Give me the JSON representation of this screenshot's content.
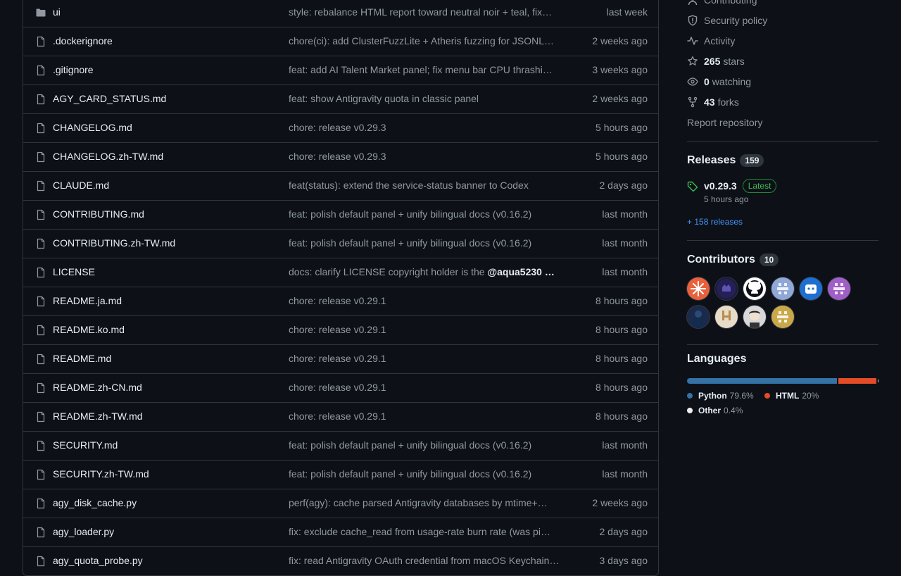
{
  "files": [
    {
      "name": "ui",
      "type": "folder",
      "message": "style: rebalance HTML report toward neutral noir + teal, fix…",
      "date": "last week"
    },
    {
      "name": ".dockerignore",
      "type": "file",
      "message": "chore(ci): add ClusterFuzzLite + Atheris fuzzing for JSONL…",
      "date": "2 weeks ago"
    },
    {
      "name": ".gitignore",
      "type": "file",
      "message": "feat: add AI Talent Market panel; fix menu bar CPU thrashi…",
      "date": "3 weeks ago"
    },
    {
      "name": "AGY_CARD_STATUS.md",
      "type": "file",
      "message": "feat: show Antigravity quota in classic panel",
      "date": "2 weeks ago"
    },
    {
      "name": "CHANGELOG.md",
      "type": "file",
      "message": "chore: release v0.29.3",
      "date": "5 hours ago"
    },
    {
      "name": "CHANGELOG.zh-TW.md",
      "type": "file",
      "message": "chore: release v0.29.3",
      "date": "5 hours ago"
    },
    {
      "name": "CLAUDE.md",
      "type": "file",
      "message": "feat(status): extend the service-status banner to Codex",
      "date": "2 days ago"
    },
    {
      "name": "CONTRIBUTING.md",
      "type": "file",
      "message": "feat: polish default panel + unify bilingual docs (v0.16.2)",
      "date": "last month"
    },
    {
      "name": "CONTRIBUTING.zh-TW.md",
      "type": "file",
      "message": "feat: polish default panel + unify bilingual docs (v0.16.2)",
      "date": "last month"
    },
    {
      "name": "LICENSE",
      "type": "file",
      "message": "docs: clarify LICENSE copyright holder is the ",
      "mention": "@aqua5230 …",
      "date": "last month"
    },
    {
      "name": "README.ja.md",
      "type": "file",
      "message": "chore: release v0.29.1",
      "date": "8 hours ago"
    },
    {
      "name": "README.ko.md",
      "type": "file",
      "message": "chore: release v0.29.1",
      "date": "8 hours ago"
    },
    {
      "name": "README.md",
      "type": "file",
      "message": "chore: release v0.29.1",
      "date": "8 hours ago"
    },
    {
      "name": "README.zh-CN.md",
      "type": "file",
      "message": "chore: release v0.29.1",
      "date": "8 hours ago"
    },
    {
      "name": "README.zh-TW.md",
      "type": "file",
      "message": "chore: release v0.29.1",
      "date": "8 hours ago"
    },
    {
      "name": "SECURITY.md",
      "type": "file",
      "message": "feat: polish default panel + unify bilingual docs (v0.16.2)",
      "date": "last month"
    },
    {
      "name": "SECURITY.zh-TW.md",
      "type": "file",
      "message": "feat: polish default panel + unify bilingual docs (v0.16.2)",
      "date": "last month"
    },
    {
      "name": "agy_disk_cache.py",
      "type": "file",
      "message": "perf(agy): cache parsed Antigravity databases by mtime+…",
      "date": "2 weeks ago"
    },
    {
      "name": "agy_loader.py",
      "type": "file",
      "message": "fix: exclude cache_read from usage-rate burn rate (was pi…",
      "date": "2 days ago"
    },
    {
      "name": "agy_quota_probe.py",
      "type": "file",
      "message": "fix: read Antigravity OAuth credential from macOS Keychain…",
      "date": "3 days ago"
    }
  ],
  "sidebar": {
    "contributing_label": "Contributing",
    "security_label": "Security policy",
    "activity_label": "Activity",
    "stars_count": "265",
    "stars_label": "stars",
    "watching_count": "0",
    "watching_label": "watching",
    "forks_count": "43",
    "forks_label": "forks",
    "report_label": "Report repository"
  },
  "releases": {
    "title": "Releases",
    "count": "159",
    "latest_tag": "v0.29.3",
    "latest_badge": "Latest",
    "latest_time": "5 hours ago",
    "more_link": "+ 158 releases"
  },
  "contributors": {
    "title": "Contributors",
    "count": "10",
    "avatars": [
      {
        "name": "avatar-1",
        "color": "#e8613c"
      },
      {
        "name": "avatar-2",
        "color": "#1a1b3a"
      },
      {
        "name": "avatar-3",
        "color": "#ffffff"
      },
      {
        "name": "avatar-4",
        "color": "#8fa8d8"
      },
      {
        "name": "avatar-5",
        "color": "#1f6fd1"
      },
      {
        "name": "avatar-6",
        "color": "#a05ec7"
      },
      {
        "name": "avatar-7",
        "color": "#1b2a4a"
      },
      {
        "name": "avatar-8",
        "color": "#e8dcc8"
      },
      {
        "name": "avatar-9",
        "color": "#d8d8d8"
      },
      {
        "name": "avatar-10",
        "color": "#c9a84a"
      }
    ]
  },
  "languages": {
    "title": "Languages",
    "items": [
      {
        "name": "Python",
        "percent": "79.6%",
        "value": 79.6,
        "color": "#3572a5"
      },
      {
        "name": "HTML",
        "percent": "20%",
        "value": 20,
        "color": "#e34c26"
      },
      {
        "name": "Other",
        "percent": "0.4%",
        "value": 0.4,
        "color": "#ededed"
      }
    ]
  },
  "colors": {
    "background": "#0d1117",
    "border": "#30363d",
    "muted": "#9198a1",
    "text": "#e6edf3",
    "link": "#4493f8",
    "green": "#3fb950"
  }
}
